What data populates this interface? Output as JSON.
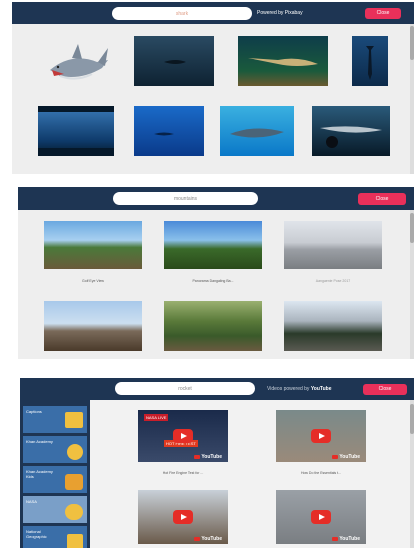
{
  "panel_pixabay": {
    "search_value": "shark",
    "powered_label": "Powered by Pixabay",
    "close_label": "Close"
  },
  "panel_360": {
    "search_value": "mountains",
    "close_label": "Close",
    "results": [
      {
        "caption": "Golf Eye View"
      },
      {
        "caption": "Panorama Dangaling Ba..."
      },
      {
        "caption": "Aangaenie Pose 2017"
      },
      {
        "caption": ""
      },
      {
        "caption": ""
      },
      {
        "caption": ""
      }
    ]
  },
  "panel_youtube": {
    "search_value": "rocket",
    "powered_prefix": "Videos powered by",
    "powered_brand": "YouTube",
    "close_label": "Close",
    "youtube_mark": "YouTube",
    "channels": [
      {
        "label": "Captions"
      },
      {
        "label": "Khan Academy"
      },
      {
        "label": "Khan Academy Kids"
      },
      {
        "label": "NASA"
      },
      {
        "label": "National Geographic"
      }
    ],
    "video_overlays": {
      "nasa_live": "NASA LIVE",
      "hot_fire": "HOT FIRE TEST"
    },
    "videos": [
      {
        "caption": "Hot Fire Engine Test for ..."
      },
      {
        "caption": "How Do the Essentials t..."
      },
      {
        "caption": ""
      },
      {
        "caption": ""
      }
    ]
  }
}
